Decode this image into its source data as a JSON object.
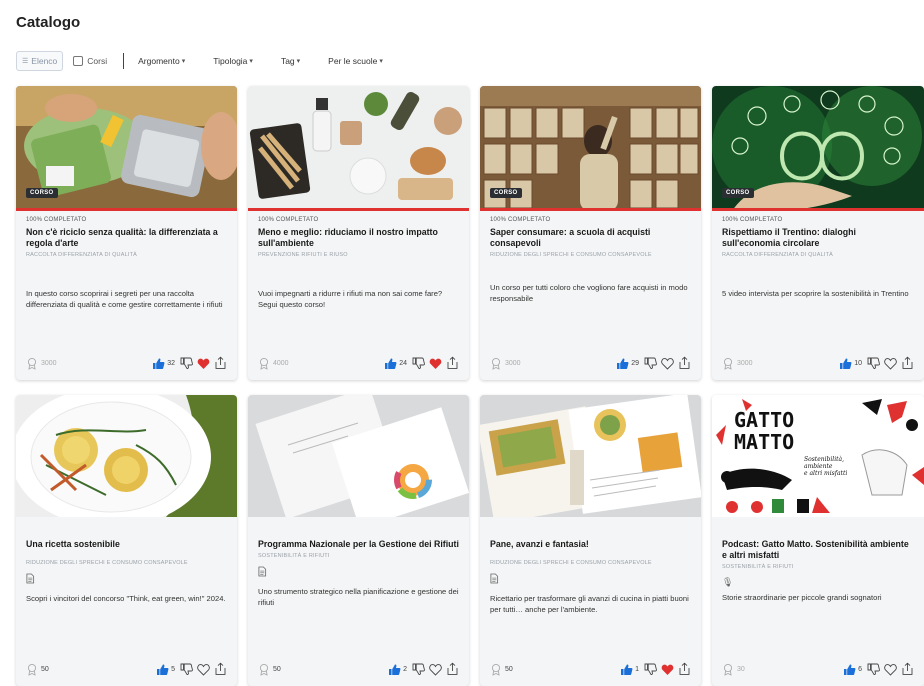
{
  "page": {
    "title": "Catalogo"
  },
  "filters": {
    "view_list": "Elenco",
    "courses_label": "Corsi",
    "dropdowns": [
      "Argomento",
      "Tipologia",
      "Tag",
      "Per le scuole"
    ]
  },
  "colors": {
    "accent_red": "#e03131",
    "like_blue": "#1b6fd8",
    "heart_red": "#e03131"
  },
  "cards": [
    {
      "badge": "CORSO",
      "progress": "100% COMPLETATO",
      "title": "Non c'è riciclo senza qualità: la differenziata a regola d'arte",
      "tags": "RACCOLTA DIFFERENZIATA DI QUALITÀ",
      "description": "In questo corso scoprirai i segreti per una raccolta differenziata di qualità e come gestire correttamente i rifiuti",
      "points": "3000",
      "likes": "32",
      "favorited": true
    },
    {
      "badge": "",
      "progress": "100% COMPLETATO",
      "title": "Meno e meglio: riduciamo il nostro impatto sull'ambiente",
      "tags": "PREVENZIONE RIFIUTI E RIUSO",
      "description": "Vuoi impegnarti a ridurre i rifiuti ma non sai come fare? Segui questo corso!",
      "points": "4000",
      "likes": "24",
      "favorited": true
    },
    {
      "badge": "CORSO",
      "progress": "100% COMPLETATO",
      "title": "Saper consumare: a scuola di acquisti consapevoli",
      "tags": "RIDUZIONE DEGLI SPRECHI E CONSUMO CONSAPEVOLE",
      "description": "Un corso per tutti coloro che vogliono fare acquisti in modo responsabile",
      "points": "3000",
      "likes": "29",
      "favorited": false
    },
    {
      "badge": "CORSO",
      "progress": "100% COMPLETATO",
      "title": "Rispettiamo il Trentino: dialoghi sull'economia circolare",
      "tags": "RACCOLTA DIFFERENZIATA DI QUALITÀ",
      "description": "5 video intervista per scoprire la sostenibilità in Trentino",
      "points": "3000",
      "likes": "10",
      "favorited": false
    },
    {
      "title": "Una ricetta sostenibile",
      "tags": "RIDUZIONE DEGLI SPRECHI E CONSUMO CONSAPEVOLE",
      "description": "Scopri i vincitori del concorso \"Think, eat green, win!\" 2024.",
      "points": "50",
      "likes": "5",
      "favorited": false
    },
    {
      "title": "Programma Nazionale per la Gestione dei Rifiuti",
      "tags": "SOSTENIBILITÀ E RIFIUTI",
      "description": "Uno strumento strategico nella pianificazione e gestione dei rifiuti",
      "points": "50",
      "likes": "2",
      "favorited": false
    },
    {
      "title": "Pane, avanzi e fantasia!",
      "tags": "RIDUZIONE DEGLI SPRECHI E CONSUMO CONSAPEVOLE",
      "description": "Ricettario per trasformare gli avanzi di cucina in piatti buoni per tutti… anche per l'ambiente.",
      "points": "50",
      "likes": "1",
      "favorited": true
    },
    {
      "title": "Podcast: Gatto Matto. Sostenibilità ambiente e altri misfatti",
      "tags": "SOSTENIBILITÀ E RIFIUTI",
      "description": "Storie straordinarie per piccole grandi sognatori",
      "points": "30",
      "likes": "6",
      "favorited": false,
      "image_text": {
        "title_line1": "GATTO",
        "title_line2": "MATTO",
        "subtitle_line1": "Sostenibilità,",
        "subtitle_line2": "ambiente",
        "subtitle_line3": "e altri misfatti"
      }
    }
  ]
}
